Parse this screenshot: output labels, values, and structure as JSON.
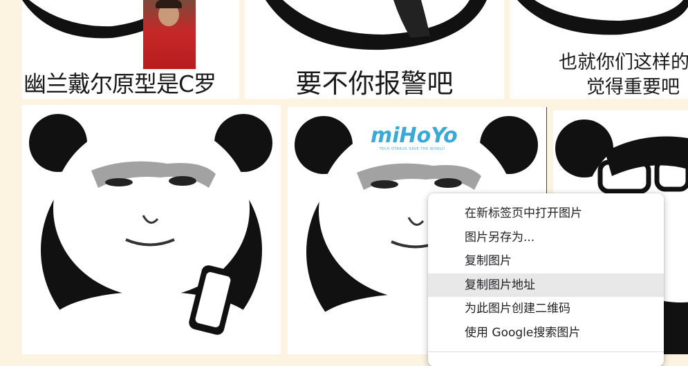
{
  "tiles": {
    "top_left_caption": "幽兰戴尔原型是C罗",
    "top_middle_caption": "要不你报警吧",
    "top_right_caption_line1": "也就你们这样的",
    "top_right_caption_line2": "觉得重要吧",
    "logo_text": "miHoYo",
    "logo_tagline": "TECH OTAKUS SAVE THE WORLD"
  },
  "context_menu": {
    "items": [
      {
        "label": "在新标签页中打开图片"
      },
      {
        "label": "图片另存为..."
      },
      {
        "label": "复制图片"
      },
      {
        "label": "复制图片地址",
        "highlighted": true
      },
      {
        "label": "为此图片创建二维码"
      },
      {
        "label": "使用 Google搜索图片"
      }
    ]
  },
  "colors": {
    "page_background": "#fdf3e1",
    "menu_highlight": "#e8e8e8",
    "logo_blue": "#3aa9d8"
  }
}
